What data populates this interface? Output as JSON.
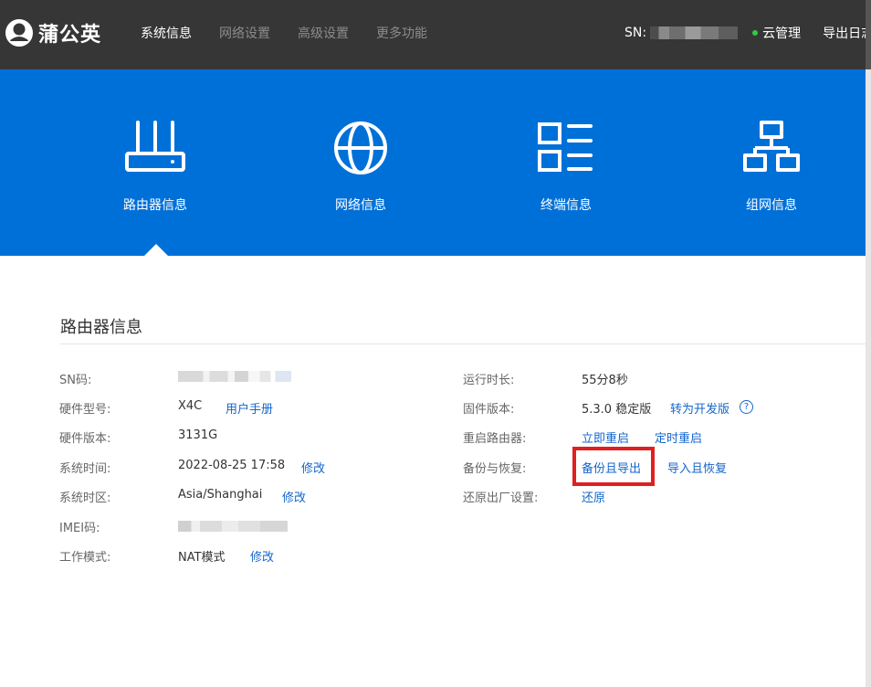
{
  "header": {
    "logo_text": "蒲公英",
    "nav": [
      "系统信息",
      "网络设置",
      "高级设置",
      "更多功能"
    ],
    "sn_prefix": "SN:",
    "cloud_label": "云管理",
    "export_log": "导出日志"
  },
  "tabs": [
    "路由器信息",
    "网络信息",
    "终端信息",
    "组网信息"
  ],
  "section_title": "路由器信息",
  "left_info": {
    "sn_label": "SN码:",
    "model_label": "硬件型号:",
    "model_value": "X4C",
    "manual_link": "用户手册",
    "hwver_label": "硬件版本:",
    "hwver_value": "3131G",
    "time_label": "系统时间:",
    "time_value": "2022-08-25 17:58",
    "time_edit": "修改",
    "tz_label": "系统时区:",
    "tz_value": "Asia/Shanghai",
    "tz_edit": "修改",
    "imei_label": "IMEI码:",
    "mode_label": "工作模式:",
    "mode_value": "NAT模式",
    "mode_edit": "修改"
  },
  "right_info": {
    "uptime_label": "运行时长:",
    "uptime_value": "55分8秒",
    "fw_label": "固件版本:",
    "fw_value": "5.3.0 稳定版",
    "fw_switch": "转为开发版",
    "fw_help": "?",
    "reboot_label": "重启路由器:",
    "reboot_now": "立即重启",
    "reboot_timed": "定时重启",
    "backup_label": "备份与恢复:",
    "backup_export": "备份且导出",
    "backup_import": "导入且恢复",
    "reset_label": "还原出厂设置:",
    "reset_action": "还原"
  },
  "colors": {
    "topbar": "#363636",
    "banner": "#0070d9",
    "link": "#1466cc",
    "highlight": "#e02020",
    "online": "#2ecc40"
  }
}
